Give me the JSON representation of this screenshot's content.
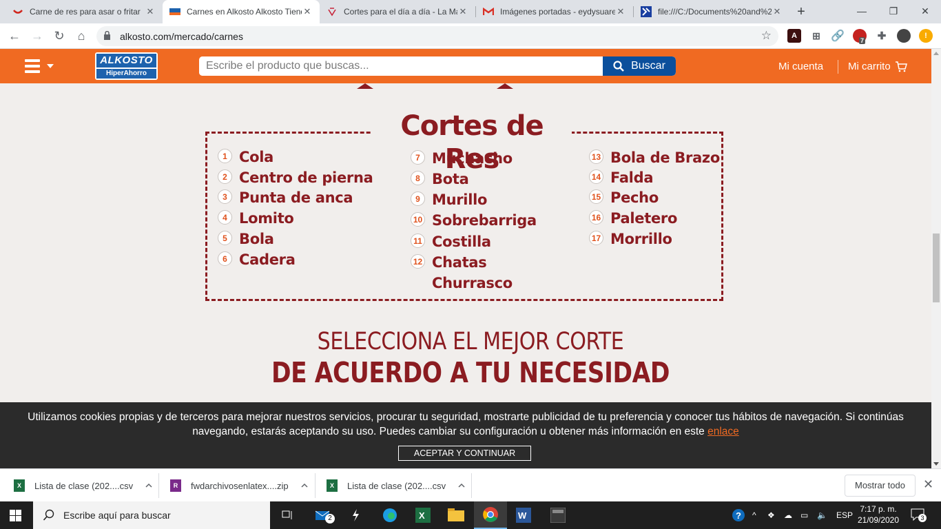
{
  "tabs": [
    {
      "title": "Carne de res para asar o fritar",
      "icon": "recipe-site-icon"
    },
    {
      "title": "Carnes en Alkosto Alkosto Tienda",
      "icon": "alkosto-icon"
    },
    {
      "title": "Cortes para el día a día - La Mag",
      "icon": "magazine-icon"
    },
    {
      "title": "Imágenes portadas - eydysuare",
      "icon": "gmail-icon"
    },
    {
      "title": "file:///C:/Documents%20and%2",
      "icon": "file-icon"
    }
  ],
  "address_bar": {
    "url": "alkosto.com/mercado/carnes"
  },
  "extensions": {
    "badge_count": "7"
  },
  "site_header": {
    "logo_top": "ALKOSTO",
    "logo_bottom": "HiperAhorro",
    "search_placeholder": "Escribe el producto que buscas...",
    "search_button": "Buscar",
    "account": "Mi cuenta",
    "cart": "Mi carrito"
  },
  "cortes": {
    "title": "Cortes de Res",
    "columns": [
      [
        {
          "num": "1",
          "name": "Cola"
        },
        {
          "num": "2",
          "name": "Centro de pierna"
        },
        {
          "num": "3",
          "name": "Punta de anca"
        },
        {
          "num": "4",
          "name": "Lomito"
        },
        {
          "num": "5",
          "name": "Bola"
        },
        {
          "num": "6",
          "name": "Cadera"
        }
      ],
      [
        {
          "num": "7",
          "name": "Muchacho"
        },
        {
          "num": "8",
          "name": "Bota"
        },
        {
          "num": "9",
          "name": "Murillo"
        },
        {
          "num": "10",
          "name": "Sobrebarriga"
        },
        {
          "num": "11",
          "name": "Costilla"
        },
        {
          "num": "12",
          "name": "Chatas Churrasco"
        }
      ],
      [
        {
          "num": "13",
          "name": "Bola de Brazo"
        },
        {
          "num": "14",
          "name": "Falda"
        },
        {
          "num": "15",
          "name": "Pecho"
        },
        {
          "num": "16",
          "name": "Paletero"
        },
        {
          "num": "17",
          "name": "Morrillo"
        }
      ]
    ]
  },
  "select_heading": {
    "line1": "SELECCIONA EL MEJOR CORTE",
    "line2": "DE ACUERDO A TU NECESIDAD"
  },
  "cookie_bar": {
    "text": "Utilizamos cookies propias y de terceros para mejorar nuestros servicios, procurar tu seguridad, mostrarte publicidad de tu preferencia y conocer tus hábitos de navegación. Si continúas navegando, estarás aceptando su uso. Puedes cambiar su configuración u obtener más información en este",
    "link": "enlace",
    "button": "ACEPTAR Y CONTINUAR"
  },
  "downloads": [
    {
      "name": "Lista de clase (202....csv",
      "icon": "excel-file-icon"
    },
    {
      "name": "fwdarchivosenlatex....zip",
      "icon": "winrar-file-icon"
    },
    {
      "name": "Lista de clase (202....csv",
      "icon": "excel-file-icon"
    }
  ],
  "show_all": "Mostrar todo",
  "taskbar": {
    "search_placeholder": "Escribe aquí para buscar",
    "mail_badge": "2",
    "language": "ESP",
    "time": "7:17 p. m.",
    "date": "21/09/2020",
    "notification_count": "3"
  },
  "colors": {
    "brand_orange": "#f06a22",
    "brand_blue": "#0b4f9c",
    "cut_red": "#8b1c21"
  }
}
